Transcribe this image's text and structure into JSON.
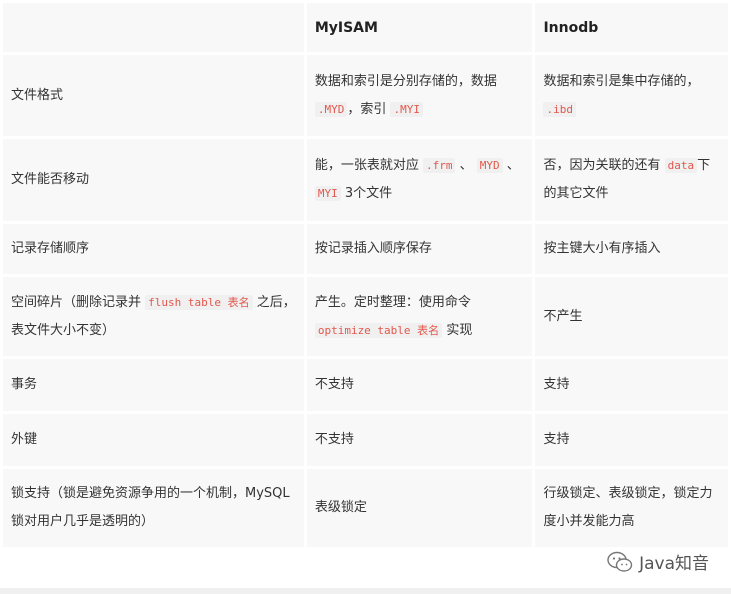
{
  "header": {
    "col1": "",
    "col2": "MyISAM",
    "col3": "Innodb"
  },
  "rows": [
    {
      "label": "文件格式",
      "myisam": [
        "数据和索引是分别存储的，数据",
        ".MYD",
        "，索引",
        ".MYI"
      ],
      "innodb": [
        "数据和索引是集中存储的，",
        ".ibd"
      ]
    },
    {
      "label": "文件能否移动",
      "myisam": [
        "能，一张表就对应",
        ".frm",
        "、",
        "MYD",
        "、",
        "MYI",
        "3个文件"
      ],
      "innodb": [
        "否，因为关联的还有",
        "data",
        "下的其它文件"
      ]
    },
    {
      "label": "记录存储顺序",
      "myisam": "按记录插入顺序保存",
      "innodb": "按主键大小有序插入"
    },
    {
      "label": [
        "空间碎片（删除记录并",
        "flush table 表名",
        "之后，表文件大小不变）"
      ],
      "myisam": [
        "产生。定时整理：使用命令",
        "optimize table 表名",
        "实现"
      ],
      "innodb": "不产生"
    },
    {
      "label": "事务",
      "myisam": "不支持",
      "innodb": "支持"
    },
    {
      "label": "外键",
      "myisam": "不支持",
      "innodb": "支持"
    },
    {
      "label": "锁支持（锁是避免资源争用的一个机制，MySQL锁对用户几乎是透明的）",
      "myisam": "表级锁定",
      "innodb": "行级锁定、表级锁定，锁定力度小并发能力高"
    }
  ],
  "watermark": {
    "text": "Java知音",
    "icon": "wechat-icon"
  }
}
